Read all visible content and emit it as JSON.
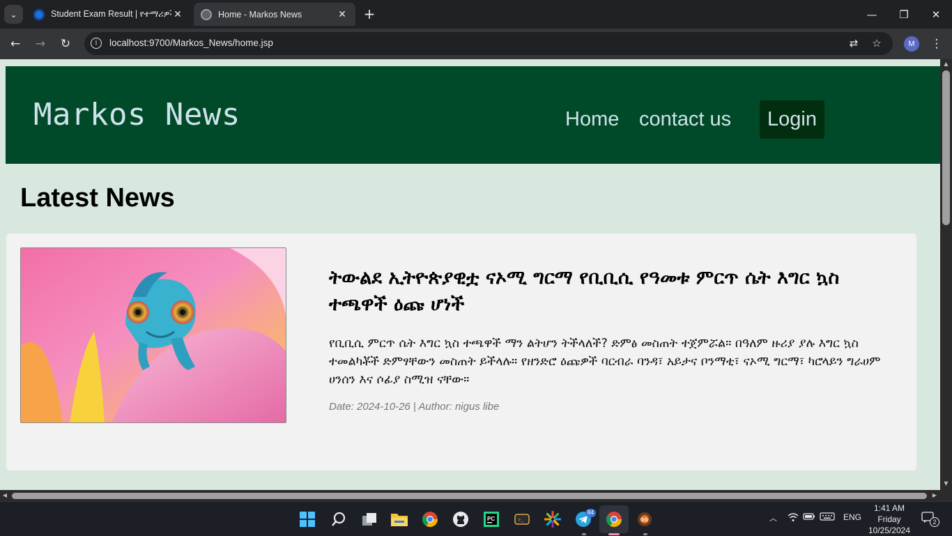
{
  "browser": {
    "tabs": [
      {
        "title": "Student Exam Result | የተማሪዎች",
        "active": false
      },
      {
        "title": "Home - Markos News",
        "active": true
      }
    ],
    "url": "localhost:9700/Markos_News/home.jsp",
    "profile_initial": "M"
  },
  "site": {
    "brand": "Markos News",
    "nav": {
      "home": "Home",
      "contact": "contact us",
      "login": "Login"
    },
    "section_title": "Latest News",
    "articles": [
      {
        "title": "ትውልደ ኢትዮጵያዊቷ ናኦሚ ግርማ የቢቢሲ የዓመቱ ምርጥ ሴት እግር ኳስ ተጫዋች ዕጩ ሆነች",
        "summary": "የቢቢሲ ምርጥ ሴት እግር ኳስ ተጫዋች ማን ልትሆን ትችላለች? ድምፅ መስጠት ተጀምሯል። በዓለም ዙሪያ ያሉ እግር ኳስ ተመልካቾች ድምፃቸውን መስጠት ይችላሉ። የዘንድሮ ዕጩዎች ባርብራ ባንዳ፣ አይታና ቦንማቲ፣ ናኦሚ ግርማ፣ ካሮላይን ግራሀም ሀንሰን እና ሶፊያ ስሚዝ ናቸው።",
        "meta": "Date: 2024-10-26 | Author: nigus libe",
        "image": "chameleon-on-flower"
      }
    ],
    "colors": {
      "header_bg": "#014a29",
      "login_bg": "#012e0e",
      "page_bg": "#d8e8de",
      "card_bg": "#f2f2f2"
    }
  },
  "taskbar": {
    "apps": [
      "windows-start",
      "search",
      "task-view",
      "file-explorer",
      "chrome",
      "github",
      "pycharm",
      "terminal",
      "app-launcher",
      "telegram",
      "chrome-active",
      "game-app"
    ],
    "telegram_badge": "84",
    "language": "ENG",
    "time": "1:41 AM",
    "day": "Friday",
    "date": "10/25/2024",
    "notifications": "2"
  }
}
